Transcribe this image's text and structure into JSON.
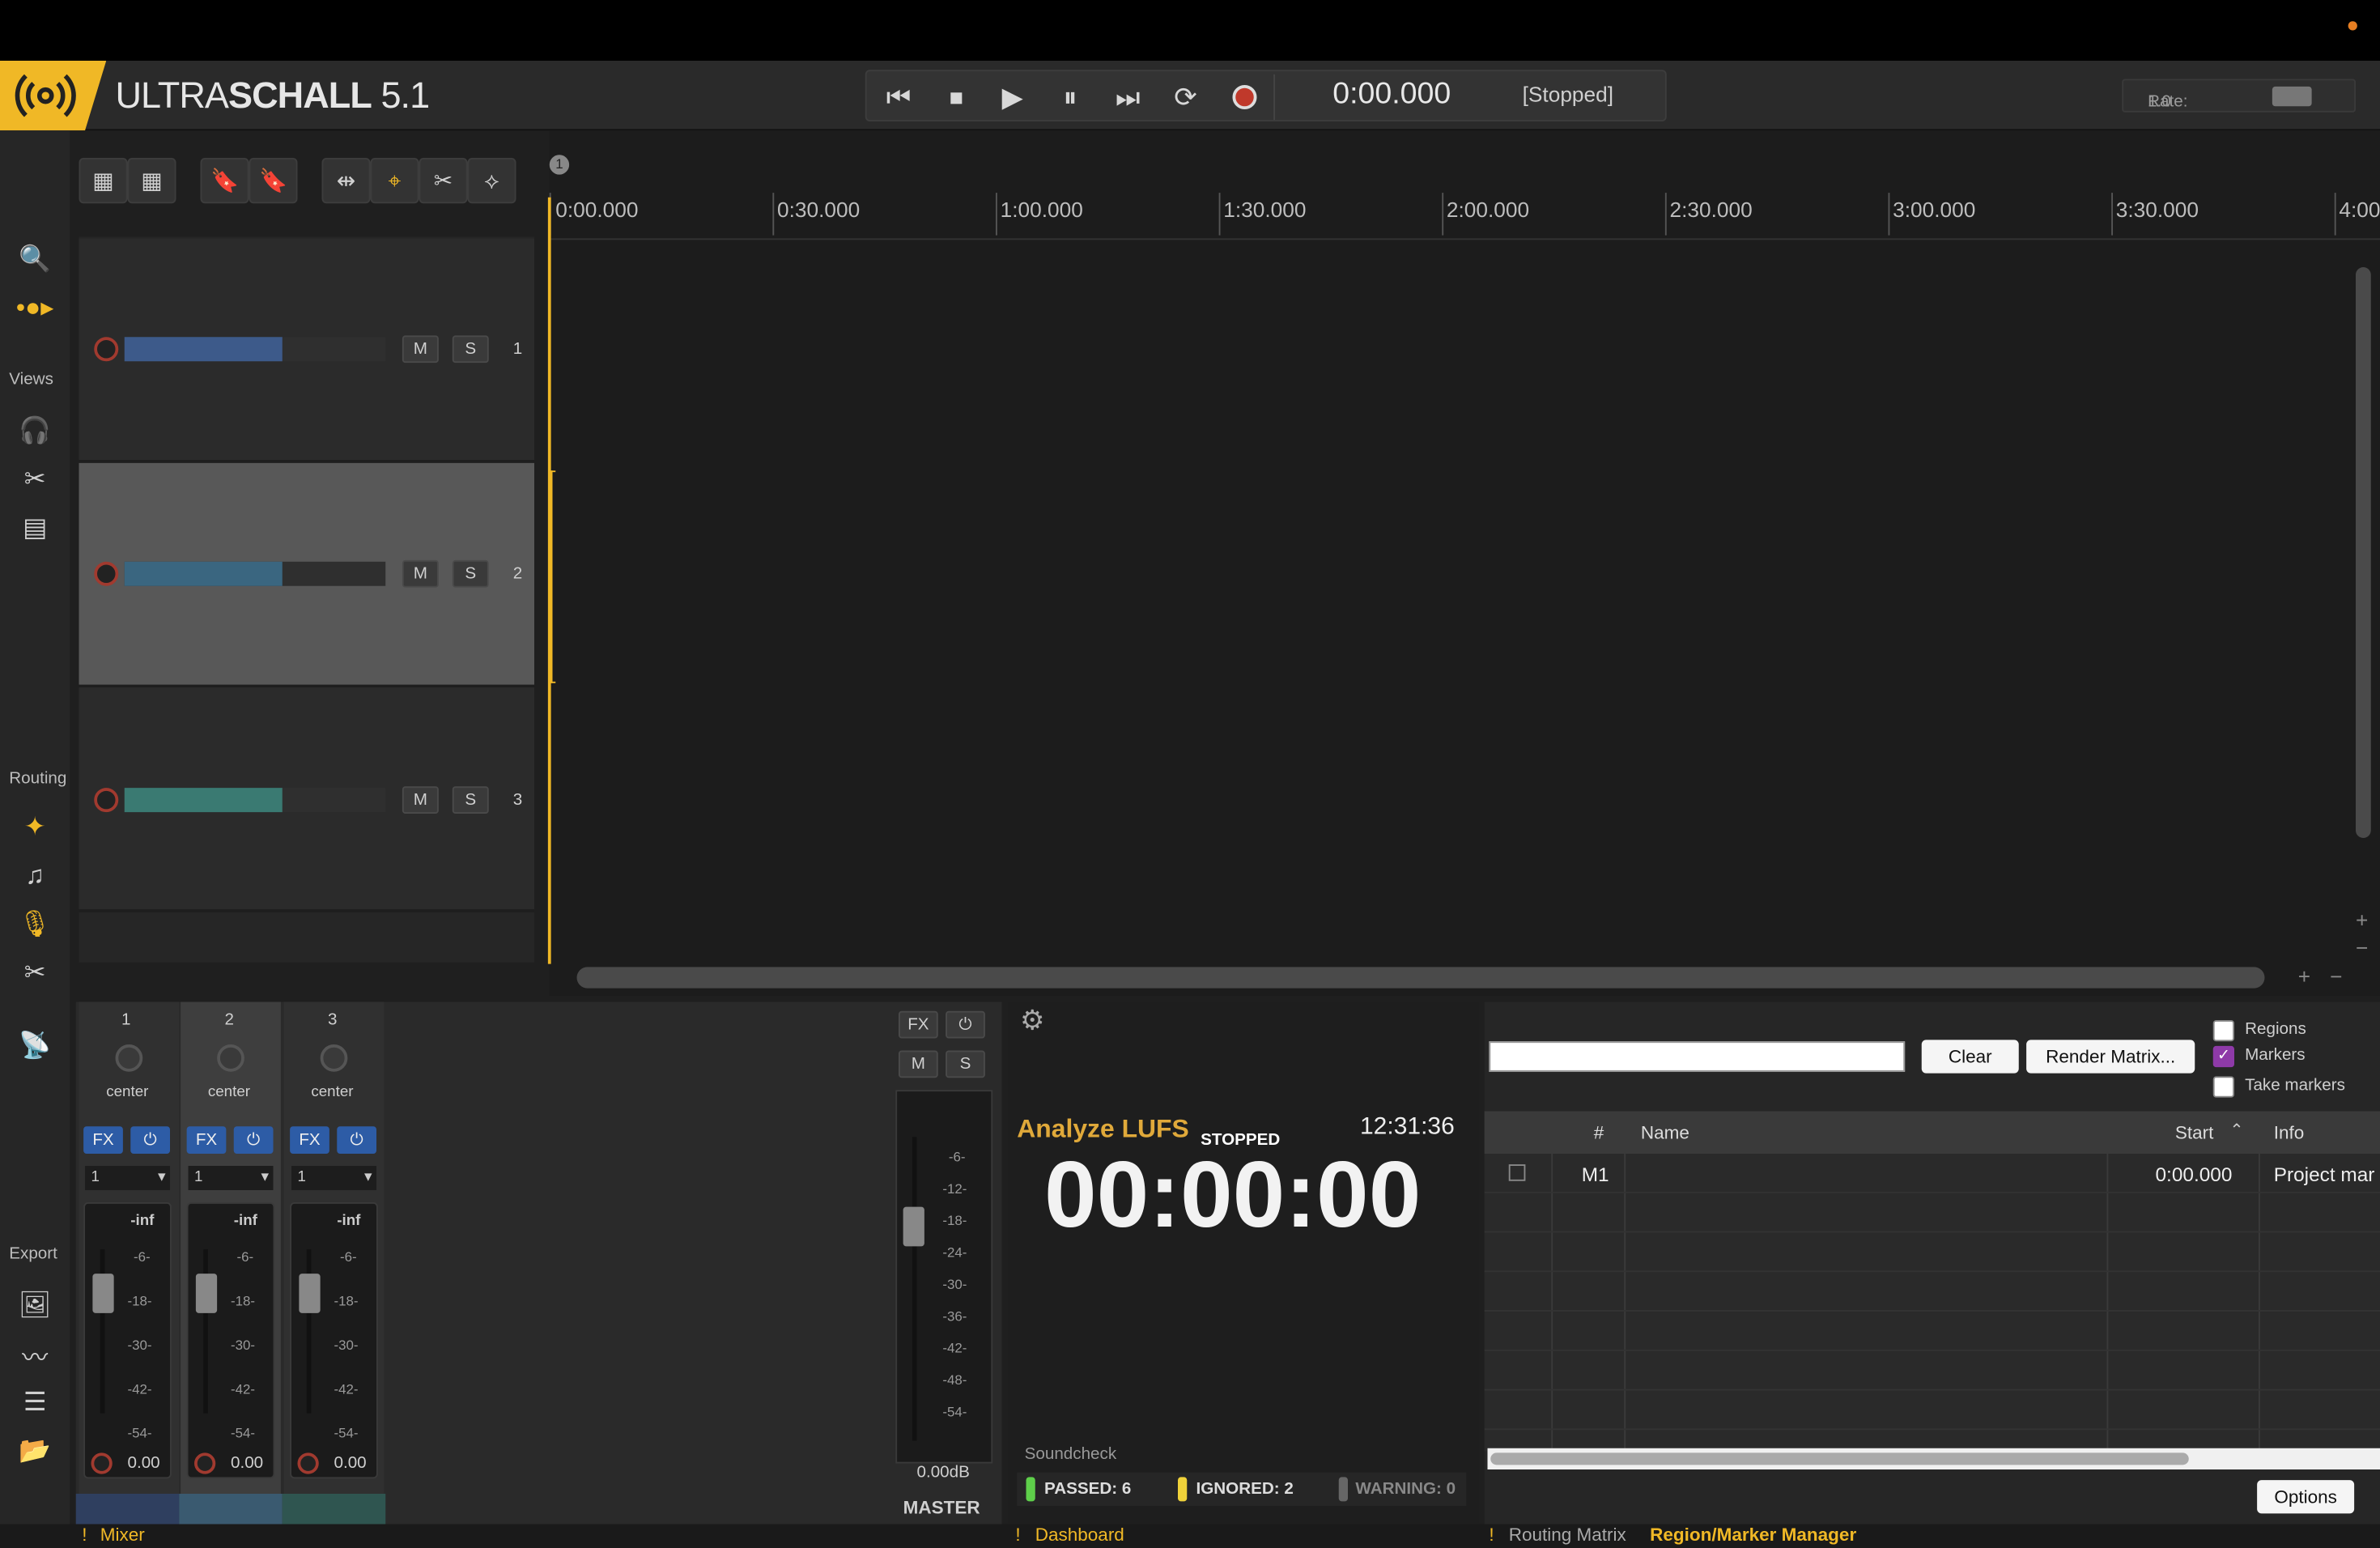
{
  "app": {
    "name_light": "ULTRA",
    "name_bold": "SCHALL",
    "version": "5.1"
  },
  "transport": {
    "time": "0:00.000",
    "status": "[Stopped]",
    "rate_label": "Rate:",
    "rate_value": "1.0"
  },
  "side": {
    "views": "Views",
    "routing": "Routing",
    "export": "Export"
  },
  "ruler": {
    "marker": "1",
    "ticks": [
      "0:00.000",
      "0:30.000",
      "1:00.000",
      "1:30.000",
      "2:00.000",
      "2:30.000",
      "3:00.000",
      "3:30.000",
      "4:00"
    ]
  },
  "tracks": [
    {
      "num": "1",
      "m": "M",
      "s": "S",
      "color": "#3d5a8a"
    },
    {
      "num": "2",
      "m": "M",
      "s": "S",
      "color": "#3a6680"
    },
    {
      "num": "3",
      "m": "M",
      "s": "S",
      "color": "#3a7a72"
    }
  ],
  "mixer": {
    "strips": [
      {
        "num": "1",
        "pan": "center",
        "fx": "FX",
        "sel": "1",
        "peak": "-inf",
        "vol": "0.00"
      },
      {
        "num": "2",
        "pan": "center",
        "fx": "FX",
        "sel": "1",
        "peak": "-inf",
        "vol": "0.00"
      },
      {
        "num": "3",
        "pan": "center",
        "fx": "FX",
        "sel": "1",
        "peak": "-inf",
        "vol": "0.00"
      }
    ],
    "scale": [
      "-6-",
      "-18-",
      "-30-",
      "-42-",
      "-54-"
    ],
    "tab": "Mixer"
  },
  "master": {
    "fx": "FX",
    "m": "M",
    "s": "S",
    "db": "0.00dB",
    "label": "MASTER",
    "scale": [
      "-6-",
      "-12-",
      "-18-",
      "-24-",
      "-30-",
      "-36-",
      "-42-",
      "-48-",
      "-54-"
    ]
  },
  "dashboard": {
    "title": "Analyze LUFS",
    "state": "STOPPED",
    "clock": "12:31:36",
    "timer": "00:00:00",
    "soundcheck": "Soundcheck",
    "passed": "PASSED: 6",
    "ignored": "IGNORED: 2",
    "warning": "WARNING: 0",
    "tab": "Dashboard"
  },
  "regions": {
    "search_value": "",
    "clear": "Clear",
    "render": "Render Matrix...",
    "opt_regions": "Regions",
    "opt_markers": "Markers",
    "opt_take": "Take markers",
    "cols": {
      "num": "#",
      "name": "Name",
      "start": "Start",
      "info": "Info"
    },
    "rows": [
      {
        "id": "M1",
        "name": "",
        "start": "0:00.000",
        "info": "Project mar"
      }
    ],
    "options": "Options",
    "tab_routing": "Routing Matrix",
    "tab_manager": "Region/Marker Manager"
  }
}
